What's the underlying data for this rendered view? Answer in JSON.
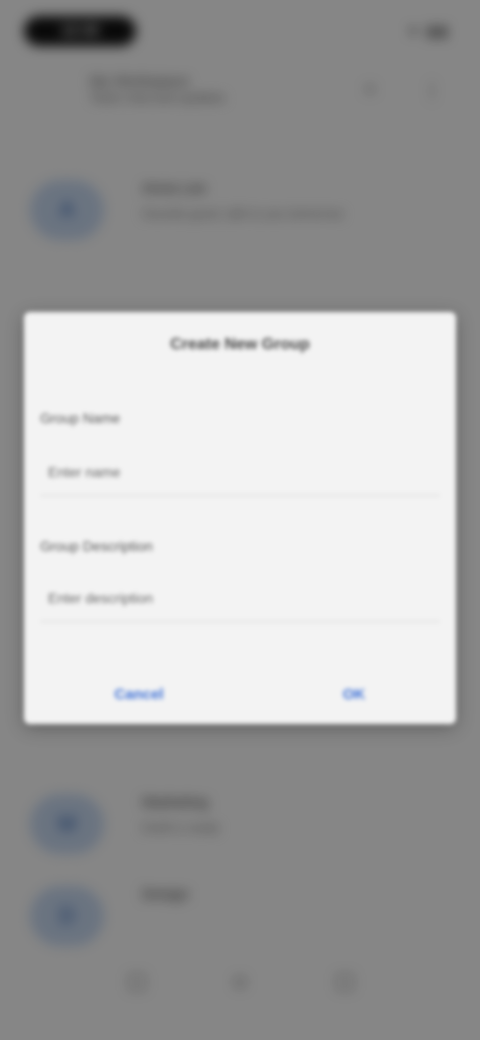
{
  "status_bar": {
    "time": "12:30",
    "icons": "▾ ▮▮"
  },
  "header": {
    "title": "My Workspace",
    "subtitle": "Team chat and updates",
    "icon_one": "○",
    "icon_two": "⋮"
  },
  "chat_items": [
    {
      "initial": "A",
      "name": "Anna Lee",
      "message": "Sounds good, talk to you tomorrow"
    },
    {
      "initial": "M",
      "name": "Marketing",
      "message": "Draft is ready"
    },
    {
      "initial": "D",
      "name": "Design",
      "message": ""
    }
  ],
  "bottom_nav": {
    "chats_icon": "□",
    "home_icon": "○",
    "profile_icon": "□"
  },
  "dialog": {
    "title": "Create New Group",
    "field1_label": "Group Name",
    "field1_placeholder": "Enter name",
    "field2_label": "Group Description",
    "field2_placeholder": "Enter description",
    "cancel_label": "Cancel",
    "ok_label": "OK"
  },
  "colors": {
    "accent": "#3b6fd6",
    "scrim": "rgba(0,0,0,0.45)"
  }
}
